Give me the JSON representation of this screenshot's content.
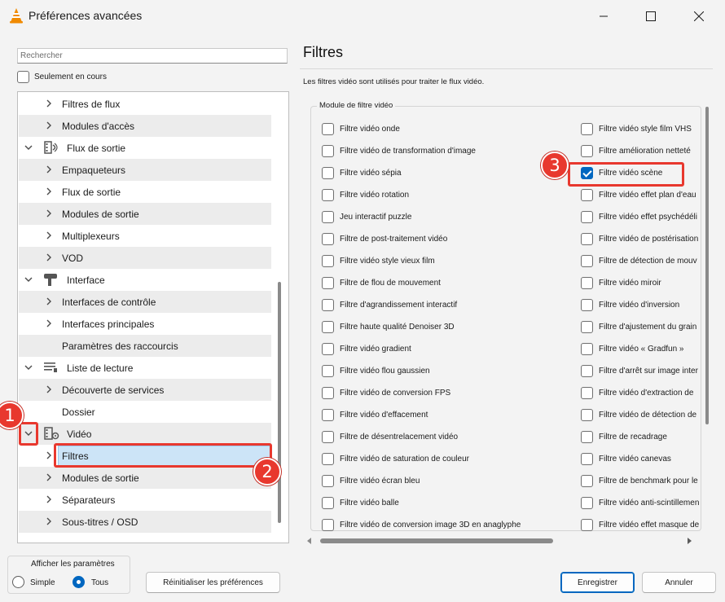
{
  "window": {
    "title": "Préférences avancées"
  },
  "search": {
    "placeholder": "Rechercher"
  },
  "only_current_label": "Seulement en cours",
  "tree": [
    {
      "label": "Filtres de flux",
      "level": 2,
      "expand": "collapsed"
    },
    {
      "label": "Modules d'accès",
      "level": 2,
      "expand": "collapsed"
    },
    {
      "label": "Flux de sortie",
      "level": 1,
      "expand": "expanded",
      "icon": "stream-output-icon"
    },
    {
      "label": "Empaqueteurs",
      "level": 2,
      "expand": "collapsed"
    },
    {
      "label": "Flux de sortie",
      "level": 2,
      "expand": "collapsed"
    },
    {
      "label": "Modules de sortie",
      "level": 2,
      "expand": "collapsed"
    },
    {
      "label": "Multiplexeurs",
      "level": 2,
      "expand": "collapsed"
    },
    {
      "label": "VOD",
      "level": 2,
      "expand": "collapsed"
    },
    {
      "label": "Interface",
      "level": 1,
      "expand": "expanded",
      "icon": "interface-icon"
    },
    {
      "label": "Interfaces de contrôle",
      "level": 2,
      "expand": "collapsed"
    },
    {
      "label": "Interfaces principales",
      "level": 2,
      "expand": "collapsed"
    },
    {
      "label": "Paramètres des raccourcis",
      "level": 2,
      "expand": "none"
    },
    {
      "label": "Liste de lecture",
      "level": 1,
      "expand": "expanded",
      "icon": "playlist-icon"
    },
    {
      "label": "Découverte de services",
      "level": 2,
      "expand": "collapsed"
    },
    {
      "label": "Dossier",
      "level": 2,
      "expand": "none"
    },
    {
      "label": "Vidéo",
      "level": 1,
      "expand": "expanded",
      "icon": "video-icon"
    },
    {
      "label": "Filtres",
      "level": 2,
      "expand": "collapsed",
      "selected": true
    },
    {
      "label": "Modules de sortie",
      "level": 2,
      "expand": "collapsed"
    },
    {
      "label": "Séparateurs",
      "level": 2,
      "expand": "collapsed"
    },
    {
      "label": "Sous-titres / OSD",
      "level": 2,
      "expand": "collapsed"
    }
  ],
  "display_params": {
    "legend": "Afficher les paramètres",
    "simple_label": "Simple",
    "all_label": "Tous",
    "selected": "Tous"
  },
  "buttons": {
    "reset": "Réinitialiser les préférences",
    "save": "Enregistrer",
    "cancel": "Annuler"
  },
  "panel": {
    "title": "Filtres",
    "description": "Les filtres vidéo sont utilisés pour traiter le flux vidéo.",
    "module_legend": "Module de filtre vidéo"
  },
  "filters_left": [
    "Filtre vidéo onde",
    "Filtre vidéo de transformation d'image",
    "Filtre vidéo sépia",
    "Filtre vidéo rotation",
    "Jeu interactif puzzle",
    "Filtre de post-traitement vidéo",
    "Filtre vidéo style vieux film",
    "Filtre de flou de mouvement",
    "Filtre d'agrandissement interactif",
    "Filtre haute qualité Denoiser 3D",
    "Filtre vidéo gradient",
    "Filtre vidéo flou gaussien",
    "Filtre vidéo de conversion FPS",
    "Filtre vidéo d'effacement",
    "Filtre de désentrelacement vidéo",
    "Filtre vidéo de saturation de couleur",
    "Filtre vidéo écran bleu",
    "Filtre vidéo balle",
    "Filtre vidéo de conversion image 3D en anaglyphe"
  ],
  "filters_right": [
    "Filtre vidéo style film VHS",
    "Filtre amélioration netteté",
    "Filtre vidéo scène",
    "Filtre vidéo effet plan d'eau",
    "Filtre vidéo effet psychédéli",
    "Filtre vidéo de postérisation",
    "Filtre de détection de mouv",
    "Filtre vidéo miroir",
    "Filtre vidéo d'inversion",
    "Filtre d'ajustement du grain",
    "Filtre vidéo « Gradfun »",
    "Filtre d'arrêt sur image inter",
    "Filtre vidéo d'extraction de",
    "Filtre vidéo de détection de",
    "Filtre de recadrage",
    "Filtre vidéo canevas",
    "Filtre de benchmark pour le",
    "Filtre vidéo anti-scintillemen",
    "Filtre vidéo effet masque de"
  ],
  "checked_right_index": 2,
  "annotations": [
    "1",
    "2",
    "3"
  ],
  "colors": {
    "accent": "#0067c0",
    "annotation": "#e8382e",
    "selection": "#cce4f7"
  }
}
